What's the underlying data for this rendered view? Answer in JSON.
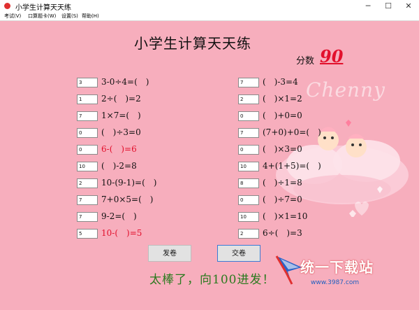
{
  "window": {
    "title": "小学生计算天天练",
    "minimize": "─",
    "maximize": "☐",
    "close": "✕"
  },
  "menu": {
    "items": [
      "考试(V)",
      "口算题卡(W)",
      "设置(S)",
      "帮助(H)"
    ]
  },
  "page": {
    "title": "小学生计算天天练",
    "score_label": "分数",
    "score_value": "90",
    "decoration_text": "Chenny"
  },
  "left_questions": [
    {
      "answer": "3",
      "expr": "3-0÷4=(　)",
      "wrong": false
    },
    {
      "answer": "1",
      "expr": "2÷(　)=2",
      "wrong": false
    },
    {
      "answer": "7",
      "expr": "1×7=(　)",
      "wrong": false
    },
    {
      "answer": "0",
      "expr": "(　)÷3=0",
      "wrong": false
    },
    {
      "answer": "0",
      "expr": "6-(　)=6",
      "wrong": true
    },
    {
      "answer": "10",
      "expr": "(　)-2=8",
      "wrong": false
    },
    {
      "answer": "2",
      "expr": "10-(9-1)=(　)",
      "wrong": false
    },
    {
      "answer": "7",
      "expr": "7+0×5=(　)",
      "wrong": false
    },
    {
      "answer": "7",
      "expr": "9-2=(　)",
      "wrong": false
    },
    {
      "answer": "5",
      "expr": "10-(　)=5",
      "wrong": true
    }
  ],
  "right_questions": [
    {
      "answer": "7",
      "expr": "(　)-3=4",
      "wrong": false
    },
    {
      "answer": "2",
      "expr": "(　)×1=2",
      "wrong": false
    },
    {
      "answer": "0",
      "expr": "(　)+0=0",
      "wrong": false
    },
    {
      "answer": "7",
      "expr": "(7+0)+0=(　)",
      "wrong": false
    },
    {
      "answer": "0",
      "expr": "(　)×3=0",
      "wrong": false
    },
    {
      "answer": "10",
      "expr": "4+(1+5)=(　)",
      "wrong": false
    },
    {
      "answer": "8",
      "expr": "(　)÷1=8",
      "wrong": false
    },
    {
      "answer": "0",
      "expr": "(　)÷7=0",
      "wrong": false
    },
    {
      "answer": "10",
      "expr": "(　)×1=10",
      "wrong": false
    },
    {
      "answer": "2",
      "expr": "6÷(　)=3",
      "wrong": false
    }
  ],
  "buttons": {
    "issue": "发卷",
    "submit": "交卷"
  },
  "message": "太棒了，向100进发！",
  "watermark": {
    "text": "统一下载站",
    "url": "www.3987.com"
  },
  "colors": {
    "background": "#f7aebd",
    "wrong": "#e2102c",
    "message": "#2a7a1e"
  }
}
